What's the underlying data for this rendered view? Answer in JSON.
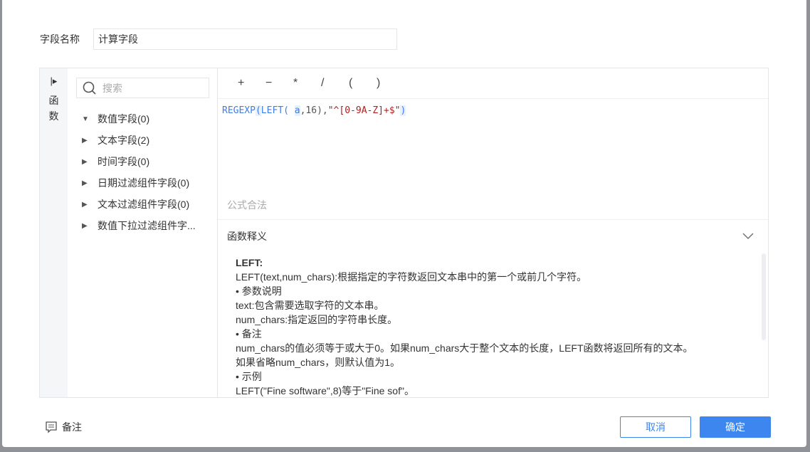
{
  "field_name": {
    "label": "字段名称",
    "value": "计算字段"
  },
  "side": {
    "label_1": "函",
    "label_2": "数"
  },
  "search": {
    "placeholder": "搜索"
  },
  "tree": [
    {
      "label": "数值字段(0)",
      "expanded": true
    },
    {
      "label": "文本字段(2)"
    },
    {
      "label": "时间字段(0)"
    },
    {
      "label": "日期过滤组件字段(0)"
    },
    {
      "label": "文本过滤组件字段(0)"
    },
    {
      "label": "数值下拉过滤组件字..."
    }
  ],
  "operators": [
    "+",
    "−",
    "*",
    "/",
    "(",
    ")"
  ],
  "formula": {
    "fn1": "REGEXP",
    "p1": "(",
    "fn2": "LEFT",
    "p2": "(",
    "arg": "a",
    "mid": ",16),",
    "str": "\"^[0-9A-Z]+$\"",
    "p3": ")"
  },
  "validity": "公式合法",
  "doc": {
    "title": "函数释义",
    "lines": [
      "LEFT:",
      "LEFT(text,num_chars):根据指定的字符数返回文本串中的第一个或前几个字符。",
      "•  参数说明",
      "text:包含需要选取字符的文本串。",
      "num_chars:指定返回的字符串长度。",
      "•  备注",
      "num_chars的值必须等于或大于0。如果num_chars大于整个文本的长度，LEFT函数将返回所有的文本。",
      "如果省略num_chars，则默认值为1。",
      "•  示例",
      "LEFT(\"Fine software\",8)等于\"Fine sof\"。"
    ]
  },
  "footer": {
    "note": "备注",
    "cancel": "取消",
    "ok": "确定"
  },
  "colors": {
    "primary": "#3d86f0"
  }
}
